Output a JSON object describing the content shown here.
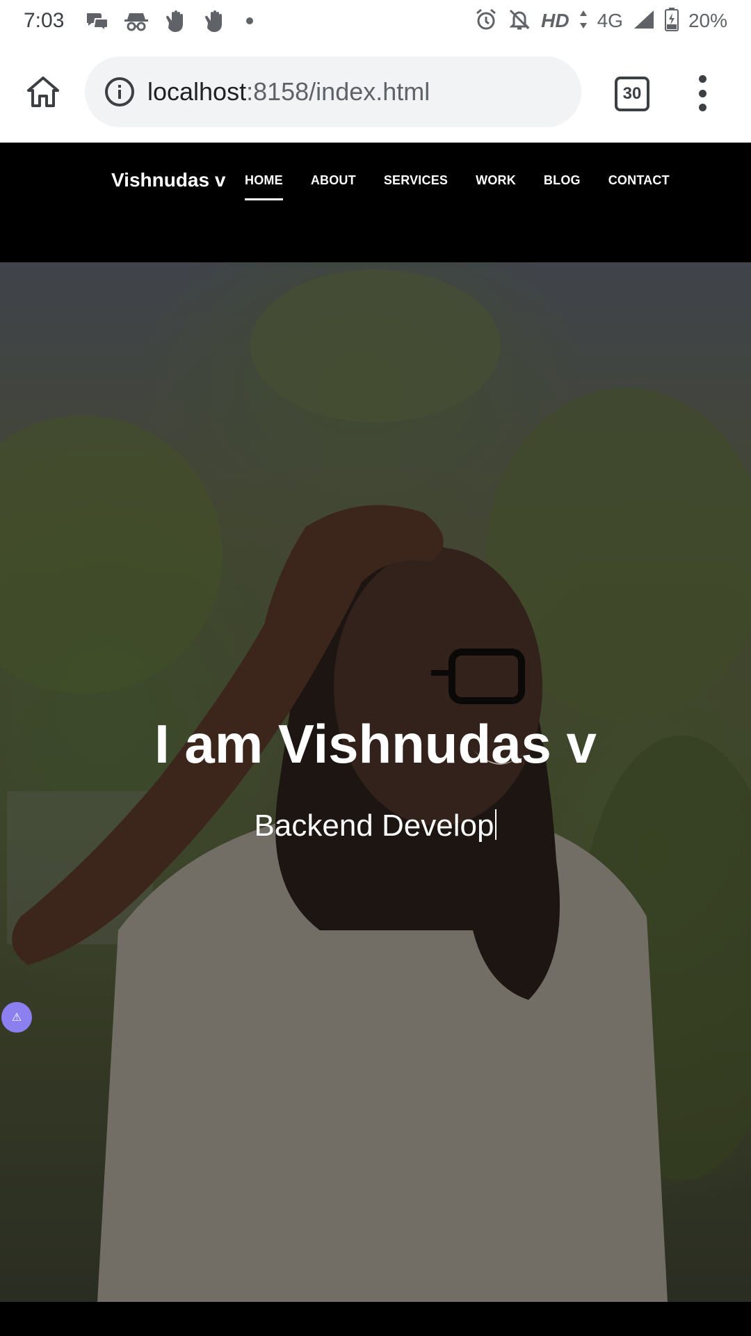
{
  "status_bar": {
    "time": "7:03",
    "network": "4G",
    "hd": "HD",
    "battery": "20%",
    "icons": [
      "chat-icon",
      "incognito-icon",
      "wave-icon",
      "wave-icon",
      "dot",
      "alarm-icon",
      "mute-icon",
      "signal-icon",
      "battery-icon"
    ]
  },
  "browser": {
    "url_host": "localhost",
    "url_rest": ":8158/index.html",
    "tab_count": "30"
  },
  "site_nav": {
    "brand": "Vishnudas v",
    "links": [
      "HOME",
      "ABOUT",
      "SERVICES",
      "WORK",
      "BLOG",
      "CONTACT"
    ],
    "active": "HOME"
  },
  "hero": {
    "title": "I am Vishnudas v",
    "subtitle": "Backend Develop",
    "badge_icon": "⚠"
  }
}
